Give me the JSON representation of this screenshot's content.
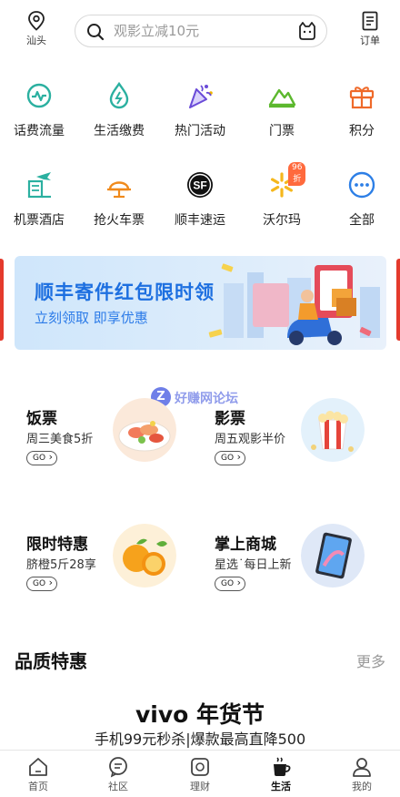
{
  "header": {
    "location": "汕头",
    "search_placeholder": "观影立减10元",
    "orders": "订单"
  },
  "services": [
    {
      "label": "话费流量",
      "icon": "phone-bill-icon"
    },
    {
      "label": "生活缴费",
      "icon": "utility-drop-icon"
    },
    {
      "label": "热门活动",
      "icon": "party-popper-icon"
    },
    {
      "label": "门票",
      "icon": "mountain-ticket-icon"
    },
    {
      "label": "积分",
      "icon": "gift-icon"
    },
    {
      "label": "机票酒店",
      "icon": "flight-hotel-icon"
    },
    {
      "label": "抢火车票",
      "icon": "train-icon"
    },
    {
      "label": "顺丰速运",
      "icon": "sf-express-icon"
    },
    {
      "label": "沃尔玛",
      "icon": "walmart-spark-icon",
      "badge": "96折"
    },
    {
      "label": "全部",
      "icon": "more-dots-icon"
    }
  ],
  "banner": {
    "title": "顺丰寄件红包限时领",
    "subtitle": "立刻领取 即享优惠"
  },
  "watermark": "好赚网论坛",
  "promos": [
    {
      "title": "饭票",
      "subtitle": "周三美食5折",
      "cta": "GO"
    },
    {
      "title": "影票",
      "subtitle": "周五观影半价",
      "cta": "GO"
    },
    {
      "title": "限时特惠",
      "subtitle": "脐橙5斤28享",
      "cta": "GO"
    },
    {
      "title": "掌上商城",
      "subtitle": "星选˙每日上新",
      "cta": "GO"
    }
  ],
  "section": {
    "title": "品质特惠",
    "more": "更多",
    "feature_title": "vivo 年货节",
    "feature_subtitle": "手机99元秒杀|爆款最高直降500"
  },
  "tabs": [
    {
      "label": "首页",
      "icon": "home-icon",
      "active": false
    },
    {
      "label": "社区",
      "icon": "community-chat-icon",
      "active": false
    },
    {
      "label": "理财",
      "icon": "finance-icon",
      "active": false
    },
    {
      "label": "生活",
      "icon": "life-cup-icon",
      "active": true
    },
    {
      "label": "我的",
      "icon": "profile-icon",
      "active": false
    }
  ],
  "colors": {
    "accent_blue": "#1d6fe0",
    "teal": "#2bb0a0",
    "orange": "#f08a1c",
    "badge": "#ff6a3d"
  }
}
